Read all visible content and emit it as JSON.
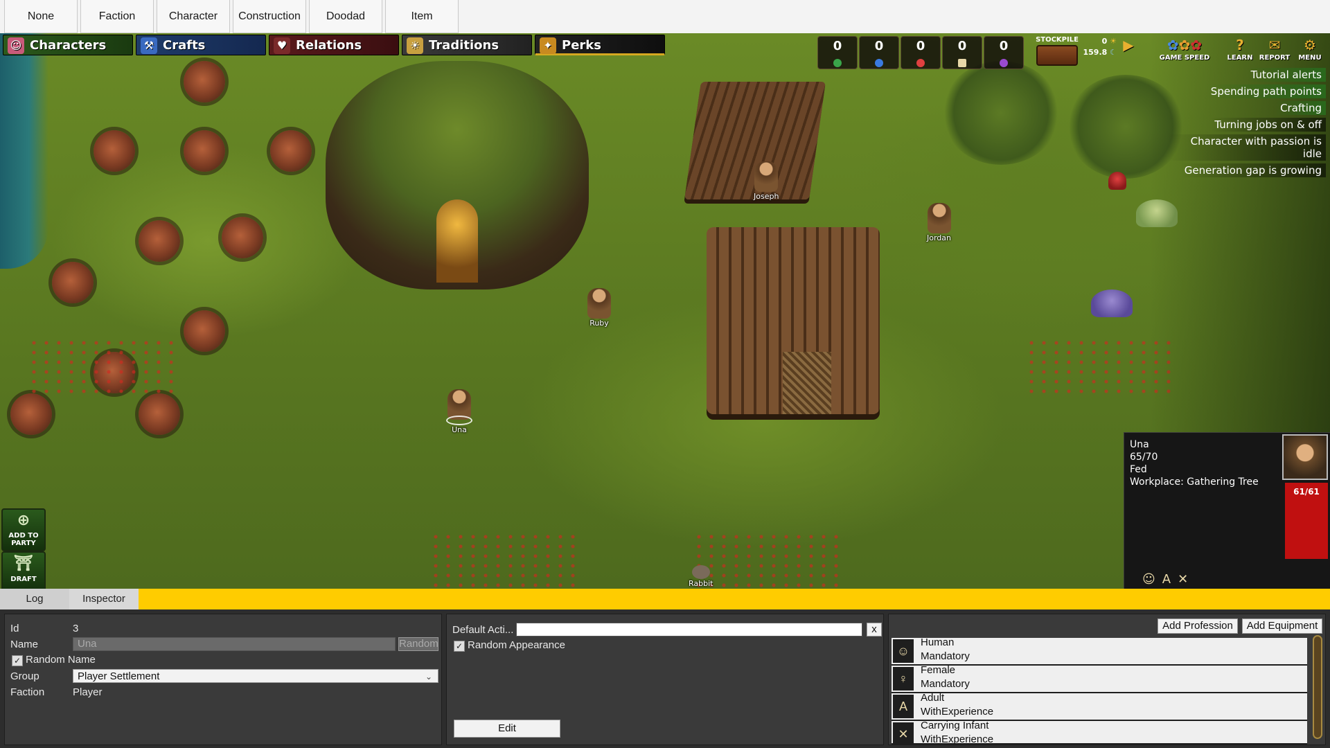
{
  "top_tabs": [
    "None",
    "Faction",
    "Character",
    "Construction",
    "Doodad",
    "Item"
  ],
  "menu": {
    "characters": "Characters",
    "crafts": "Crafts",
    "relations": "Relations",
    "traditions": "Traditions",
    "perks": "Perks"
  },
  "resources": [
    {
      "value": "0",
      "color": "#3aa64a"
    },
    {
      "value": "0",
      "color": "#3a7ae0"
    },
    {
      "value": "0",
      "color": "#e04040"
    },
    {
      "value": "0",
      "color": "#e8d8a8"
    },
    {
      "value": "0",
      "color": "#9a4ad0"
    }
  ],
  "stockpile": {
    "label": "STOCKPILE"
  },
  "counter": {
    "top": "0",
    "bottom": "159.8"
  },
  "top_buttons": {
    "game_speed": "GAME SPEED",
    "learn": "LEARN",
    "report": "REPORT",
    "menu": "MENU"
  },
  "alerts": [
    {
      "text": "Tutorial alerts",
      "style": "green"
    },
    {
      "text": "Spending path points",
      "style": "green"
    },
    {
      "text": "Crafting",
      "style": "green"
    },
    {
      "text": "Turning jobs on & off",
      "style": "dark"
    },
    {
      "text": "Character with passion is idle",
      "style": "dark"
    },
    {
      "text": "Generation gap is growing",
      "style": "dark"
    }
  ],
  "units": {
    "joseph": "Joseph",
    "jordan": "Jordan",
    "ruby": "Ruby",
    "una": "Una",
    "rabbit": "Rabbit"
  },
  "character_panel": {
    "name": "Una",
    "health": "65/70",
    "status": "Fed",
    "workplace": "Workplace: Gathering Tree",
    "hp_value": "61/61"
  },
  "side_buttons": {
    "add_to_party": "ADD TO PARTY",
    "draft": "DRAFT"
  },
  "bottom_tabs": {
    "log": "Log",
    "inspector": "Inspector"
  },
  "inspector": {
    "id_label": "Id",
    "id_value": "3",
    "name_label": "Name",
    "name_value": "Una",
    "random_button": "Random",
    "random_name_label": "Random Name",
    "group_label": "Group",
    "group_value": "Player Settlement",
    "faction_label": "Faction",
    "faction_value": "Player",
    "default_action_label": "Default Acti...",
    "clear_button": "x",
    "random_appearance_label": "Random Appearance",
    "edit_button": "Edit",
    "add_profession": "Add Profession",
    "add_equipment": "Add Equipment",
    "traits": [
      {
        "name": "Human",
        "kind": "Mandatory",
        "icon": "human-icon"
      },
      {
        "name": "Female",
        "kind": "Mandatory",
        "icon": "female-icon"
      },
      {
        "name": "Adult",
        "kind": "WithExperience",
        "icon": "adult-icon"
      },
      {
        "name": "Carrying Infant",
        "kind": "WithExperience",
        "icon": "infant-icon"
      }
    ]
  }
}
